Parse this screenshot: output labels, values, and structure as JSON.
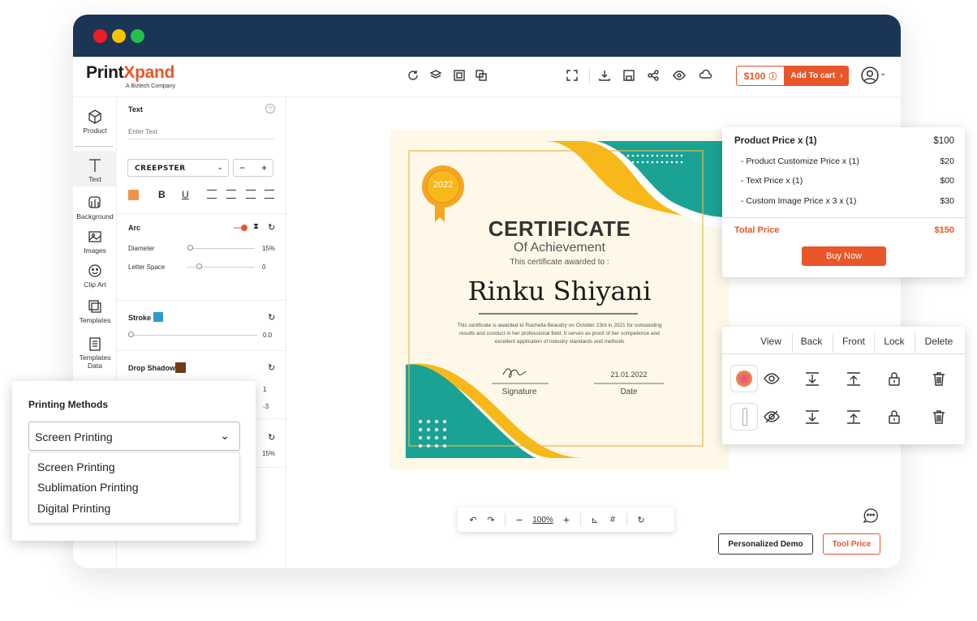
{
  "app": {
    "logo_prefix": "Print",
    "logo_x": "X",
    "logo_suffix": "pand",
    "logo_tagline": "A Biztech Company"
  },
  "toolbar": {
    "price": "$100",
    "add_to_cart": "Add To cart"
  },
  "sidebar": {
    "items": [
      {
        "label": "Product",
        "icon": "cube-icon"
      },
      {
        "label": "Text",
        "icon": "text-icon"
      },
      {
        "label": "Background",
        "icon": "background-icon"
      },
      {
        "label": "Images",
        "icon": "image-icon"
      },
      {
        "label": "Clip Art",
        "icon": "smiley-icon"
      },
      {
        "label": "Templates",
        "icon": "templates-icon"
      },
      {
        "label": "Templates Data",
        "icon": "clipboard-icon"
      }
    ]
  },
  "text_panel": {
    "title": "Text",
    "placeholder": "Enter Text",
    "font": "CREEPSTER",
    "stepper_minus": "−",
    "stepper_plus": "+",
    "color": "#f0944c",
    "bold": "B",
    "underline": "U",
    "arc_title": "Arc",
    "diameter_label": "Diameter",
    "diameter_value": "15%",
    "letter_space_label": "Letter Space",
    "letter_space_value": "0",
    "stroke_title": "Stroke",
    "stroke_color": "#2b9bd6",
    "stroke_value": "0.0",
    "shadow_title": "Drop Shadow",
    "shadow_color": "#6b3d1a",
    "shadow_v1": "1",
    "shadow_v2": "-3",
    "blur_value": "15%"
  },
  "certificate": {
    "badge": "2022",
    "title": "CERTIFICATE",
    "subtitle": "Of Achievement",
    "awarded": "This certificate awarded to :",
    "name": "Rinku Shiyani",
    "body1": "This certificate is awarded to Rachella Beaudry on October 23rd in 2021 for outstanding",
    "body2": "results and conduct in her professional field. It serves as proof of her competence and",
    "body3": "excellent application of industry standards and methods",
    "date_value": "21.01.2022",
    "signature_label": "Signature",
    "date_label": "Date"
  },
  "zoom": {
    "value": "100%"
  },
  "buttons": {
    "personalized_demo": "Personalized Demo",
    "tool_price": "Tool Price"
  },
  "price_card": {
    "rows": [
      {
        "label": "Product Price  x  (1)",
        "value": "$100"
      },
      {
        "label": "- Product Customize Price  x  (1)",
        "value": "$20"
      },
      {
        "label": "- Text Price x (1)",
        "value": "$00"
      },
      {
        "label": "- Custom Image Price x 3 x  (1)",
        "value": "$30"
      }
    ],
    "total_label": "Total Price",
    "total_value": "$150",
    "buy_now": "Buy Now"
  },
  "layers": {
    "headers": [
      "View",
      "Back",
      "Front",
      "Lock",
      "Delete"
    ]
  },
  "printing": {
    "title": "Printing Methods",
    "selected": "Screen Printing",
    "options": [
      "Screen Printing",
      "Sublimation Printing",
      "Digital Printing"
    ]
  },
  "colors": {
    "accent": "#e8562a",
    "titlebar": "#1b3556",
    "teal": "#1aa394",
    "yellow": "#f7b919"
  }
}
